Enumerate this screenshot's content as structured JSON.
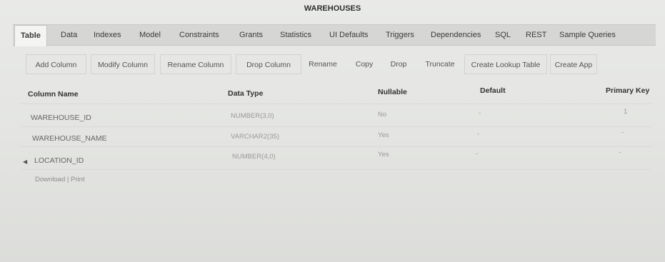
{
  "window": {
    "title": "WAREHOUSES"
  },
  "tabs": [
    {
      "label": "Table",
      "active": true
    },
    {
      "label": "Data"
    },
    {
      "label": "Indexes"
    },
    {
      "label": "Model"
    },
    {
      "label": "Constraints"
    },
    {
      "label": "Grants"
    },
    {
      "label": "Statistics"
    },
    {
      "label": "UI Defaults"
    },
    {
      "label": "Triggers"
    },
    {
      "label": "Dependencies"
    },
    {
      "label": "SQL"
    },
    {
      "label": "REST"
    },
    {
      "label": "Sample Queries"
    }
  ],
  "toolbar": {
    "buttons": [
      "Add Column",
      "Modify Column",
      "Rename Column",
      "Drop Column",
      "Rename",
      "Copy",
      "Drop",
      "Truncate",
      "Create Lookup Table",
      "Create App"
    ]
  },
  "table": {
    "headers": [
      "Column Name",
      "Data Type",
      "Nullable",
      "Default",
      "Primary Key"
    ],
    "rows": [
      {
        "column_name": "WAREHOUSE_ID",
        "data_type": "NUMBER(3,0)",
        "nullable": "No",
        "default": "-",
        "primary_key": "1"
      },
      {
        "column_name": "WAREHOUSE_NAME",
        "data_type": "VARCHAR2(35)",
        "nullable": "Yes",
        "default": "-",
        "primary_key": "-"
      },
      {
        "column_name": "LOCATION_ID",
        "data_type": "NUMBER(4,0)",
        "nullable": "Yes",
        "default": "-",
        "primary_key": "-"
      }
    ]
  },
  "footer": {
    "download": "Download",
    "separator": "|",
    "print": "Print"
  }
}
